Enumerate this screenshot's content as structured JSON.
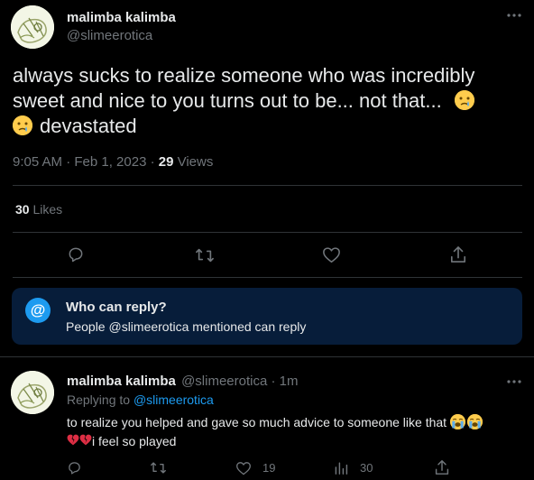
{
  "main_tweet": {
    "author_name": "malimba kalimba",
    "author_handle": "@slimeerotica",
    "text_line1": "always sucks to realize someone who was incredibly",
    "text_line2": "sweet and nice to you turns out to be... not that...",
    "text_line3": "devastated",
    "time": "9:05 AM · Feb 1, 2023 · ",
    "views_count": "29",
    "views_label": " Views",
    "likes_count": "30",
    "likes_label": " Likes"
  },
  "who_can_reply": {
    "title": "Who can reply?",
    "subtitle": "People @slimeerotica mentioned can reply"
  },
  "reply": {
    "author_name": "malimba kalimba",
    "author_handle": "@slimeerotica",
    "time": "· 1m",
    "replying_prefix": "Replying to ",
    "replying_to": "@slimeerotica",
    "text_line1": "to realize you helped and gave so much advice to someone like that",
    "text_line2": "i feel so played",
    "likes": "19",
    "views": "30"
  },
  "icons": {
    "more": "more-icon",
    "reply": "reply-icon",
    "retweet": "retweet-icon",
    "like": "like-icon",
    "share": "share-icon",
    "views": "views-icon",
    "at": "at-icon"
  },
  "colors": {
    "accent": "#1d9bf0",
    "muted": "#71767b",
    "card": "#071d3a"
  }
}
